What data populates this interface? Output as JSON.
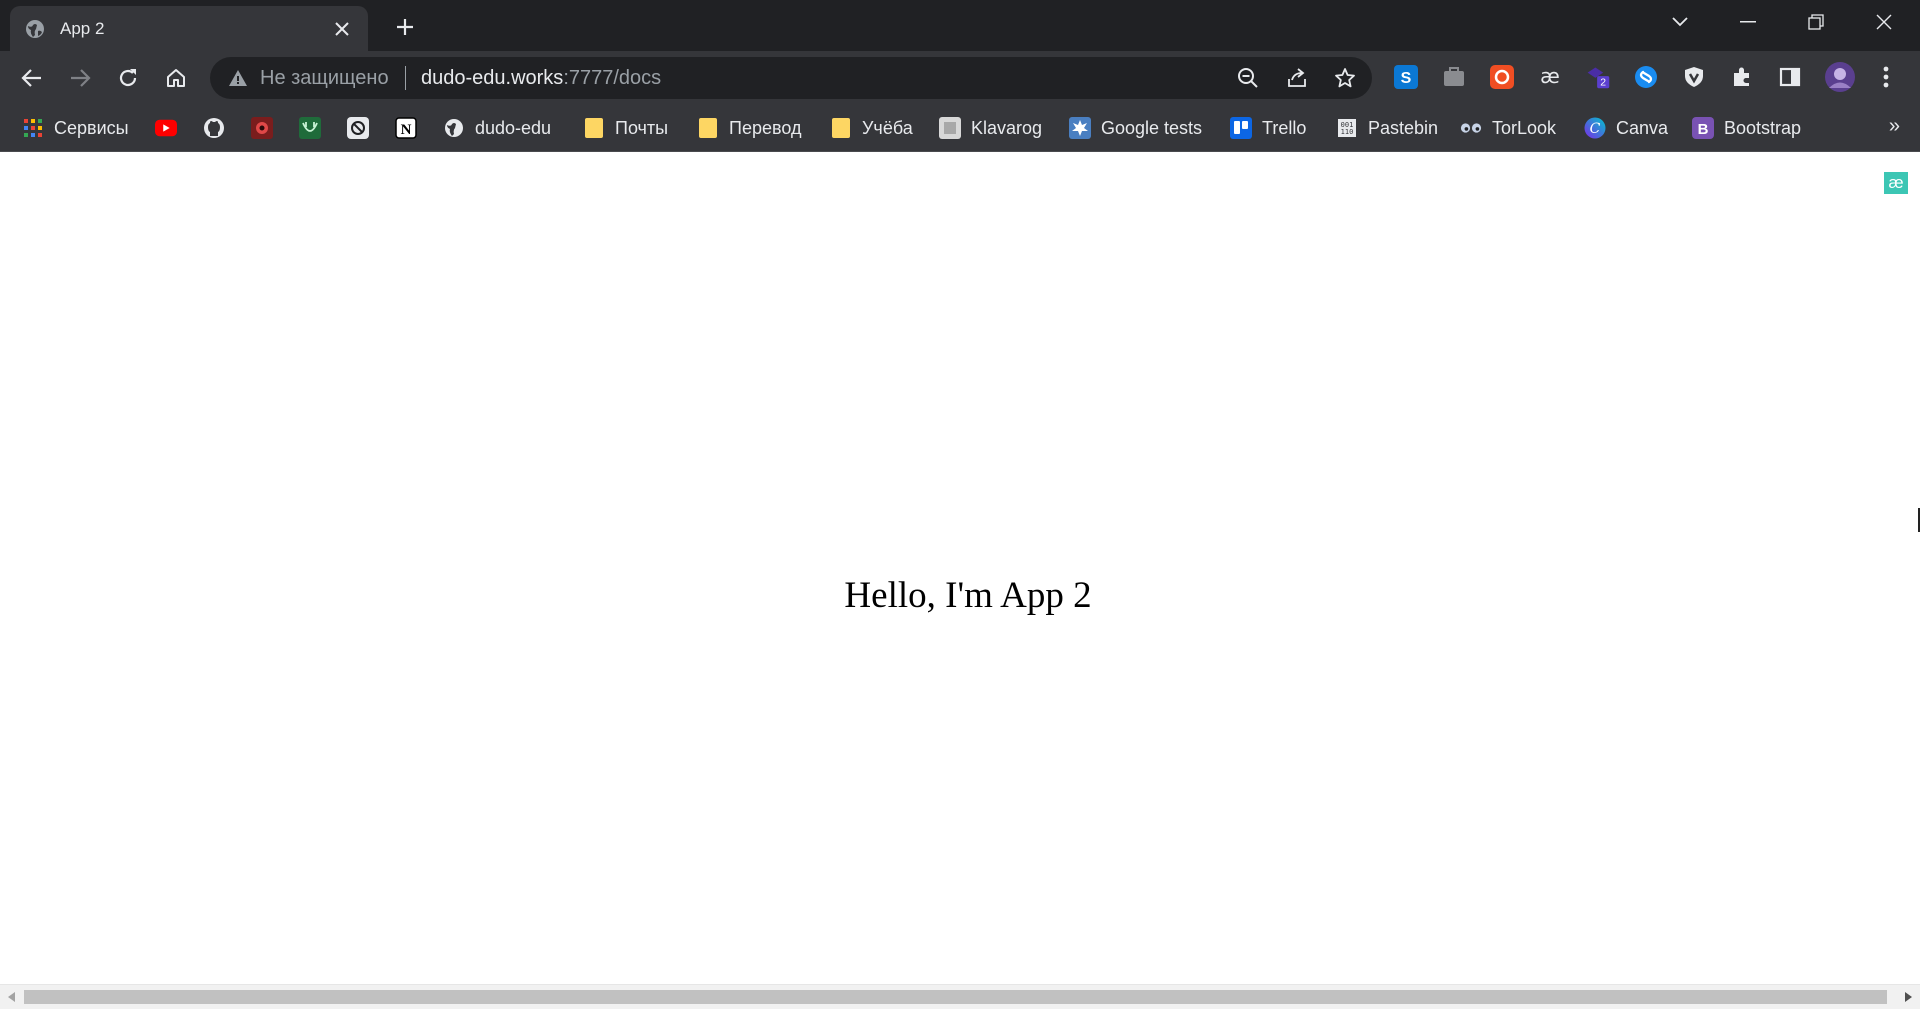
{
  "window": {
    "controls": [
      "tab-search",
      "minimize",
      "restore",
      "close"
    ]
  },
  "tab": {
    "title": "App 2",
    "favicon": "globe-icon"
  },
  "toolbar": {
    "security_label": "Не защищено",
    "url_host": "dudo-edu.works",
    "url_path": ":7777/docs"
  },
  "extensions": [
    "skype",
    "briefcase",
    "record",
    "ae-dictionary",
    "badge-2",
    "shazam",
    "shield",
    "puzzle",
    "side-panel",
    "profile",
    "menu"
  ],
  "extension_badge": "2",
  "bookmarks": [
    {
      "label": "Сервисы",
      "icon": "apps-grid-icon"
    },
    {
      "label": "",
      "icon": "youtube-icon"
    },
    {
      "label": "",
      "icon": "github-icon"
    },
    {
      "label": "",
      "icon": "red-app-icon"
    },
    {
      "label": "",
      "icon": "green-app-icon"
    },
    {
      "label": "",
      "icon": "chatgpt-icon"
    },
    {
      "label": "",
      "icon": "notion-icon"
    },
    {
      "label": "dudo-edu",
      "icon": "globe-icon"
    },
    {
      "label": "Почты",
      "icon": "folder-icon"
    },
    {
      "label": "Перевод",
      "icon": "folder-icon"
    },
    {
      "label": "Учёба",
      "icon": "folder-icon"
    },
    {
      "label": "Klavarog",
      "icon": "keyboard-icon"
    },
    {
      "label": "Google tests",
      "icon": "splash-icon"
    },
    {
      "label": "Trello",
      "icon": "trello-icon"
    },
    {
      "label": "Pastebin",
      "icon": "pastebin-icon"
    },
    {
      "label": "TorLook",
      "icon": "eyes-icon"
    },
    {
      "label": "Canva",
      "icon": "canva-icon"
    },
    {
      "label": "Bootstrap",
      "icon": "bootstrap-icon"
    }
  ],
  "bookmarks_more": "»",
  "page": {
    "heading": "Hello, I'm App 2",
    "ae_badge": "æ"
  }
}
